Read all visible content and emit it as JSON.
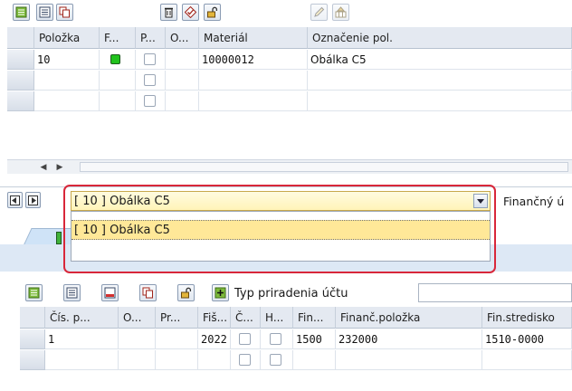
{
  "top_toolbar": {
    "buttons": [
      "details-icon",
      "detail-item-icon",
      "copy-icon",
      "delete-icon",
      "check-icon",
      "unlock-icon",
      "edit-icon",
      "distribute-icon"
    ]
  },
  "items_table": {
    "headers": [
      "Položka",
      "F...",
      "P...",
      "O...",
      "Materiál",
      "Označenie pol."
    ],
    "rows": [
      {
        "item": "10",
        "status_color": "#21c21d",
        "material": "10000012",
        "description": "Obálka C5"
      },
      {
        "item": "",
        "material": "",
        "description": ""
      },
      {
        "item": "",
        "material": "",
        "description": ""
      }
    ]
  },
  "item_selector": {
    "selected": "[ 10 ] Obálka C5",
    "options": [
      "[ 10 ] Obálka C5"
    ],
    "tab_label": "Finančný ú"
  },
  "lower_toolbar": {
    "buttons": [
      "details-icon",
      "detail-item-icon",
      "delete-row-icon",
      "copy-icon",
      "unlock-icon",
      "add-row-icon"
    ],
    "assignment_label": "Typ priradenia účtu"
  },
  "account_table": {
    "headers": [
      "Čís. p...",
      "O...",
      "Pr...",
      "Fiš...",
      "Č...",
      "H...",
      "Fin...",
      "Finanč.položka",
      "Fin.stredisko"
    ],
    "rows": [
      {
        "num": "1",
        "year": "2022",
        "fin": "1500",
        "fin_item": "232000",
        "fin_center": "1510-0000"
      },
      {
        "num": "",
        "year": "",
        "fin": "",
        "fin_item": "",
        "fin_center": ""
      }
    ]
  },
  "colors": {
    "header_bg": "#e4e9f1",
    "dropdown_bg": "#fff4b8",
    "highlight_frame": "#d8273a",
    "selected_option": "#ffe898"
  }
}
